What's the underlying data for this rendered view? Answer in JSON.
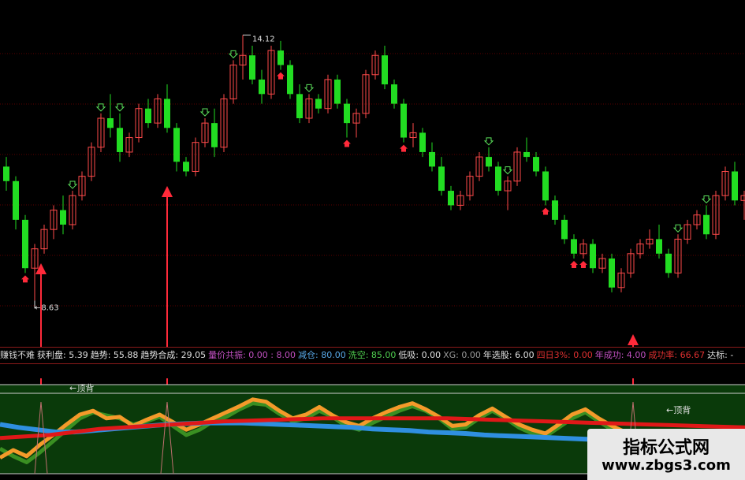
{
  "chart_data": [
    {
      "type": "candlestick",
      "ylim": [
        8.0,
        14.6
      ],
      "annotations": {
        "high_label": "14.12",
        "low_label": "←8.63"
      },
      "candles": [
        [
          11.4,
          11.6,
          10.9,
          11.1
        ],
        [
          11.1,
          11.2,
          10.1,
          10.3
        ],
        [
          10.3,
          10.4,
          9.2,
          9.3
        ],
        [
          9.3,
          9.8,
          8.63,
          9.7
        ],
        [
          9.7,
          10.2,
          9.6,
          10.1
        ],
        [
          10.1,
          10.6,
          9.9,
          10.5
        ],
        [
          10.5,
          10.8,
          10.0,
          10.2
        ],
        [
          10.2,
          10.9,
          10.1,
          10.8
        ],
        [
          10.8,
          11.3,
          10.7,
          11.2
        ],
        [
          11.2,
          11.9,
          11.1,
          11.8
        ],
        [
          11.8,
          12.5,
          11.7,
          12.4
        ],
        [
          12.4,
          12.9,
          12.0,
          12.2
        ],
        [
          12.2,
          12.5,
          11.5,
          11.7
        ],
        [
          11.7,
          12.1,
          11.6,
          12.0
        ],
        [
          12.0,
          12.7,
          11.9,
          12.6
        ],
        [
          12.6,
          12.8,
          12.2,
          12.3
        ],
        [
          12.3,
          12.9,
          12.2,
          12.8
        ],
        [
          12.8,
          13.1,
          12.1,
          12.2
        ],
        [
          12.2,
          12.3,
          11.3,
          11.5
        ],
        [
          11.5,
          11.6,
          11.2,
          11.3
        ],
        [
          11.3,
          12.0,
          11.2,
          11.9
        ],
        [
          11.9,
          12.4,
          11.8,
          12.3
        ],
        [
          12.3,
          12.6,
          11.6,
          11.8
        ],
        [
          11.8,
          12.9,
          11.7,
          12.8
        ],
        [
          12.8,
          13.6,
          12.7,
          13.5
        ],
        [
          13.5,
          14.12,
          13.2,
          13.7
        ],
        [
          13.7,
          13.9,
          13.1,
          13.2
        ],
        [
          13.2,
          13.4,
          12.7,
          12.9
        ],
        [
          12.9,
          13.9,
          12.8,
          13.8
        ],
        [
          13.8,
          14.0,
          13.4,
          13.5
        ],
        [
          13.5,
          13.6,
          12.8,
          12.9
        ],
        [
          12.9,
          13.1,
          12.3,
          12.4
        ],
        [
          12.4,
          12.9,
          12.3,
          12.8
        ],
        [
          12.8,
          12.9,
          12.5,
          12.6
        ],
        [
          12.6,
          13.3,
          12.5,
          13.2
        ],
        [
          13.2,
          13.3,
          12.6,
          12.7
        ],
        [
          12.7,
          12.8,
          12.0,
          12.3
        ],
        [
          12.3,
          12.6,
          12.0,
          12.5
        ],
        [
          12.5,
          13.4,
          12.4,
          13.3
        ],
        [
          13.3,
          13.8,
          13.2,
          13.7
        ],
        [
          13.7,
          13.9,
          13.0,
          13.1
        ],
        [
          13.1,
          13.2,
          12.6,
          12.7
        ],
        [
          12.7,
          12.8,
          11.9,
          12.0
        ],
        [
          12.0,
          12.3,
          11.8,
          12.1
        ],
        [
          12.1,
          12.2,
          11.6,
          11.7
        ],
        [
          11.7,
          11.9,
          11.3,
          11.4
        ],
        [
          11.4,
          11.6,
          10.8,
          10.9
        ],
        [
          10.9,
          11.0,
          10.5,
          10.6
        ],
        [
          10.6,
          10.9,
          10.5,
          10.8
        ],
        [
          10.8,
          11.3,
          10.7,
          11.2
        ],
        [
          11.2,
          11.7,
          11.1,
          11.6
        ],
        [
          11.6,
          11.8,
          11.3,
          11.4
        ],
        [
          11.4,
          11.5,
          10.8,
          10.9
        ],
        [
          10.9,
          11.2,
          10.5,
          11.1
        ],
        [
          11.1,
          11.8,
          11.0,
          11.7
        ],
        [
          11.7,
          12.0,
          11.5,
          11.6
        ],
        [
          11.6,
          11.7,
          11.2,
          11.3
        ],
        [
          11.3,
          11.4,
          10.6,
          10.7
        ],
        [
          10.7,
          10.8,
          10.2,
          10.3
        ],
        [
          10.3,
          10.4,
          9.8,
          9.9
        ],
        [
          9.9,
          10.0,
          9.5,
          9.6
        ],
        [
          9.6,
          9.9,
          9.5,
          9.8
        ],
        [
          9.8,
          9.9,
          9.2,
          9.3
        ],
        [
          9.3,
          9.6,
          9.2,
          9.5
        ],
        [
          9.5,
          9.6,
          8.8,
          8.9
        ],
        [
          8.9,
          9.3,
          8.8,
          9.2
        ],
        [
          9.2,
          9.7,
          9.1,
          9.6
        ],
        [
          9.6,
          9.9,
          9.5,
          9.8
        ],
        [
          9.8,
          10.1,
          9.7,
          9.9
        ],
        [
          9.9,
          10.2,
          9.5,
          9.6
        ],
        [
          9.6,
          9.7,
          9.1,
          9.2
        ],
        [
          9.2,
          10.0,
          9.1,
          9.9
        ],
        [
          9.9,
          10.3,
          9.8,
          10.2
        ],
        [
          10.2,
          10.5,
          10.1,
          10.4
        ],
        [
          10.4,
          10.6,
          9.9,
          10.0
        ],
        [
          10.0,
          10.9,
          9.9,
          10.8
        ],
        [
          10.8,
          11.4,
          10.7,
          11.3
        ],
        [
          11.3,
          11.5,
          10.6,
          10.7
        ],
        [
          10.7,
          10.9,
          10.3,
          10.8
        ]
      ]
    },
    {
      "type": "line",
      "ylim": [
        0,
        100
      ],
      "series": [
        {
          "color": "#f49a2a",
          "values": [
            18,
            28,
            20,
            35,
            48,
            62,
            75,
            80,
            70,
            72,
            60,
            68,
            75,
            65,
            55,
            62,
            70,
            78,
            86,
            95,
            92,
            80,
            70,
            75,
            85,
            74,
            65,
            60,
            70,
            78,
            85,
            90,
            82,
            72,
            60,
            62,
            74,
            83,
            72,
            62,
            55,
            50,
            62,
            75,
            82,
            70,
            60,
            52,
            45,
            40,
            36,
            32,
            30,
            35,
            28,
            25,
            22
          ]
        },
        {
          "color": "#3a8f22",
          "values": [
            30,
            20,
            12,
            25,
            40,
            55,
            70,
            78,
            74,
            70,
            62,
            66,
            72,
            60,
            48,
            55,
            66,
            72,
            82,
            90,
            88,
            76,
            66,
            70,
            80,
            72,
            60,
            55,
            64,
            72,
            80,
            86,
            80,
            70,
            56,
            58,
            70,
            80,
            70,
            58,
            50,
            46,
            58,
            70,
            78,
            66,
            55,
            48,
            40,
            34,
            30,
            25,
            20,
            28,
            22,
            18,
            15
          ]
        },
        {
          "color": "#e01818",
          "values": [
            44,
            46,
            48,
            52,
            56,
            58,
            60,
            62,
            64,
            66,
            67,
            68,
            69,
            70,
            70,
            70,
            70,
            70,
            70,
            69,
            68,
            67,
            66,
            65,
            64,
            63,
            62,
            61,
            60,
            59,
            58
          ]
        },
        {
          "color": "#2f8fe0",
          "values": [
            62,
            58,
            55,
            52,
            52,
            54,
            56,
            58,
            60,
            62,
            63,
            64,
            64,
            64,
            63,
            62,
            61,
            60,
            59,
            58,
            56,
            55,
            54,
            52,
            51,
            50,
            48,
            47,
            46,
            45,
            44,
            43,
            42,
            41,
            40,
            39,
            38,
            37,
            36,
            35,
            35
          ]
        }
      ]
    }
  ],
  "main_chart": {
    "high_value": "14.12",
    "low_value": "←8.63"
  },
  "status_bar": {
    "items": [
      {
        "text": "赚钱不难",
        "color": "#d8d8d8"
      },
      {
        "text": "获利盘: 5.39",
        "color": "#e0e0e0"
      },
      {
        "text": "趋势: 55.88",
        "color": "#e0e0e0"
      },
      {
        "text": "趋势合成: 29.05",
        "color": "#e0e0e0"
      },
      {
        "text": "量价共振: 0.00 : 8.00",
        "color": "#c050c0"
      },
      {
        "text": "减仓: 80.00",
        "color": "#58a8e8"
      },
      {
        "text": "洗空: 85.00",
        "color": "#50d050"
      },
      {
        "text": "低吸: 0.00",
        "color": "#e0e0e0"
      },
      {
        "text": "XG: 0.00",
        "color": "#9a9a9a"
      },
      {
        "text": "年选股: 6.00",
        "color": "#e0e0e0"
      },
      {
        "text": "四日3%: 0.00",
        "color": "#e03030"
      },
      {
        "text": "年成功: 4.00",
        "color": "#c050c0"
      },
      {
        "text": "成功率: 66.67",
        "color": "#e03030"
      },
      {
        "text": "达标: -",
        "color": "#e0e0e0"
      }
    ]
  },
  "sub_chart": {
    "top_label_left": "←顶背",
    "top_label_right": "←顶背"
  },
  "colors": {
    "up": "#ff4a4a",
    "down": "#22dd22",
    "arrow": "#ff2a3a",
    "grid": "#7a0000",
    "sub_bg": "#0a3a0a"
  },
  "watermark": {
    "title": "指标公式网",
    "url": "www.zbgs3.com"
  }
}
